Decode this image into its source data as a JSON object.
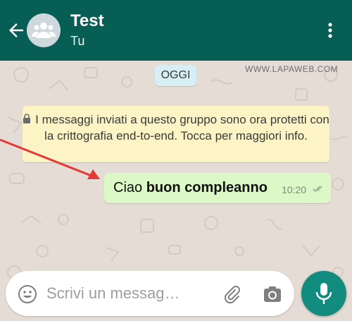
{
  "header": {
    "title": "Test",
    "subtitle": "Tu",
    "icons": {
      "back": "arrow-left-icon",
      "avatar": "group-icon",
      "menu": "kebab-menu-icon"
    }
  },
  "chat": {
    "date_chip": "OGGI",
    "watermark": "WWW.LAPAWEB.COM",
    "encryption_notice": "I messaggi inviati a questo gruppo sono ora protetti con la crittografia end-to-end. Tocca per maggiori info.",
    "message": {
      "text_regular": "Ciao ",
      "text_bold": "buon compleanno",
      "time": "10:20",
      "status_icon": "double-check-icon"
    }
  },
  "composer": {
    "placeholder": "Scrivi un messag…",
    "icons": {
      "emoji": "emoji-icon",
      "attach": "paperclip-icon",
      "camera": "camera-icon",
      "mic": "microphone-icon"
    }
  },
  "colors": {
    "header_bg": "#075e54",
    "wallpaper": "#e5ddd5",
    "outgoing_bubble": "#dcf8c6",
    "notice_bg": "#fdf4c5",
    "mic_button": "#128c7e",
    "annotation_arrow": "#e53935"
  }
}
